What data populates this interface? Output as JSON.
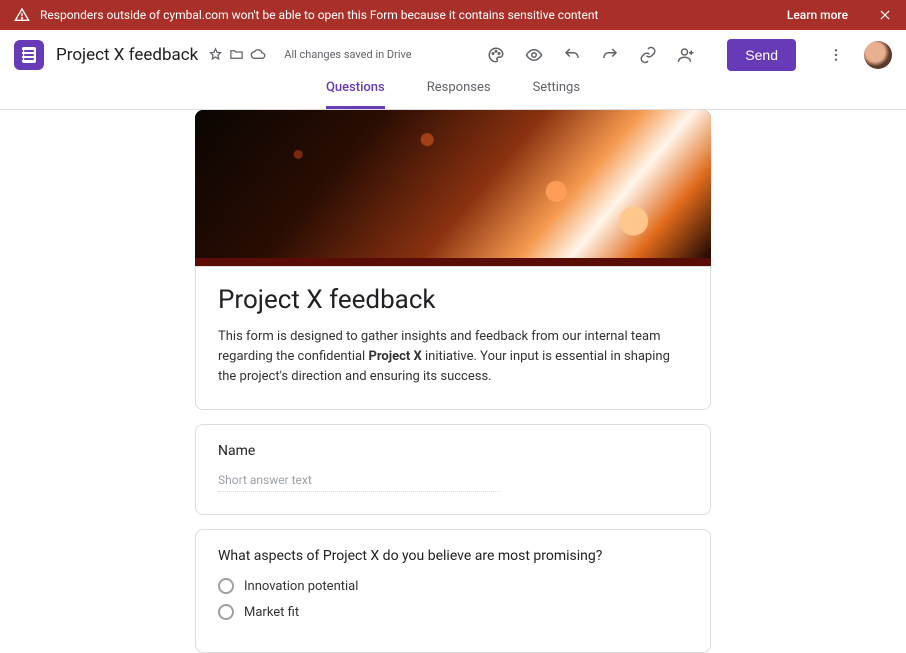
{
  "banner": {
    "text": "Responders outside of cymbal.com won't be able to open this Form because it contains sensitive content",
    "learn_more": "Learn more"
  },
  "header": {
    "doc_title": "Project X feedback",
    "save_status": "All changes saved in Drive",
    "send_label": "Send"
  },
  "tabs": {
    "questions": "Questions",
    "responses": "Responses",
    "settings": "Settings"
  },
  "form": {
    "title": "Project X feedback",
    "description_pre": "This form is designed to gather insights and feedback from our internal team regarding the confidential ",
    "description_bold": "Project X",
    "description_post": " initiative. Your input is essential in shaping the project's direction and ensuring its success."
  },
  "q1": {
    "title": "Name",
    "placeholder": "Short answer text"
  },
  "q2": {
    "title": "What aspects of Project X do you believe are most promising?",
    "opt1": "Innovation potential",
    "opt2": "Market fit"
  }
}
